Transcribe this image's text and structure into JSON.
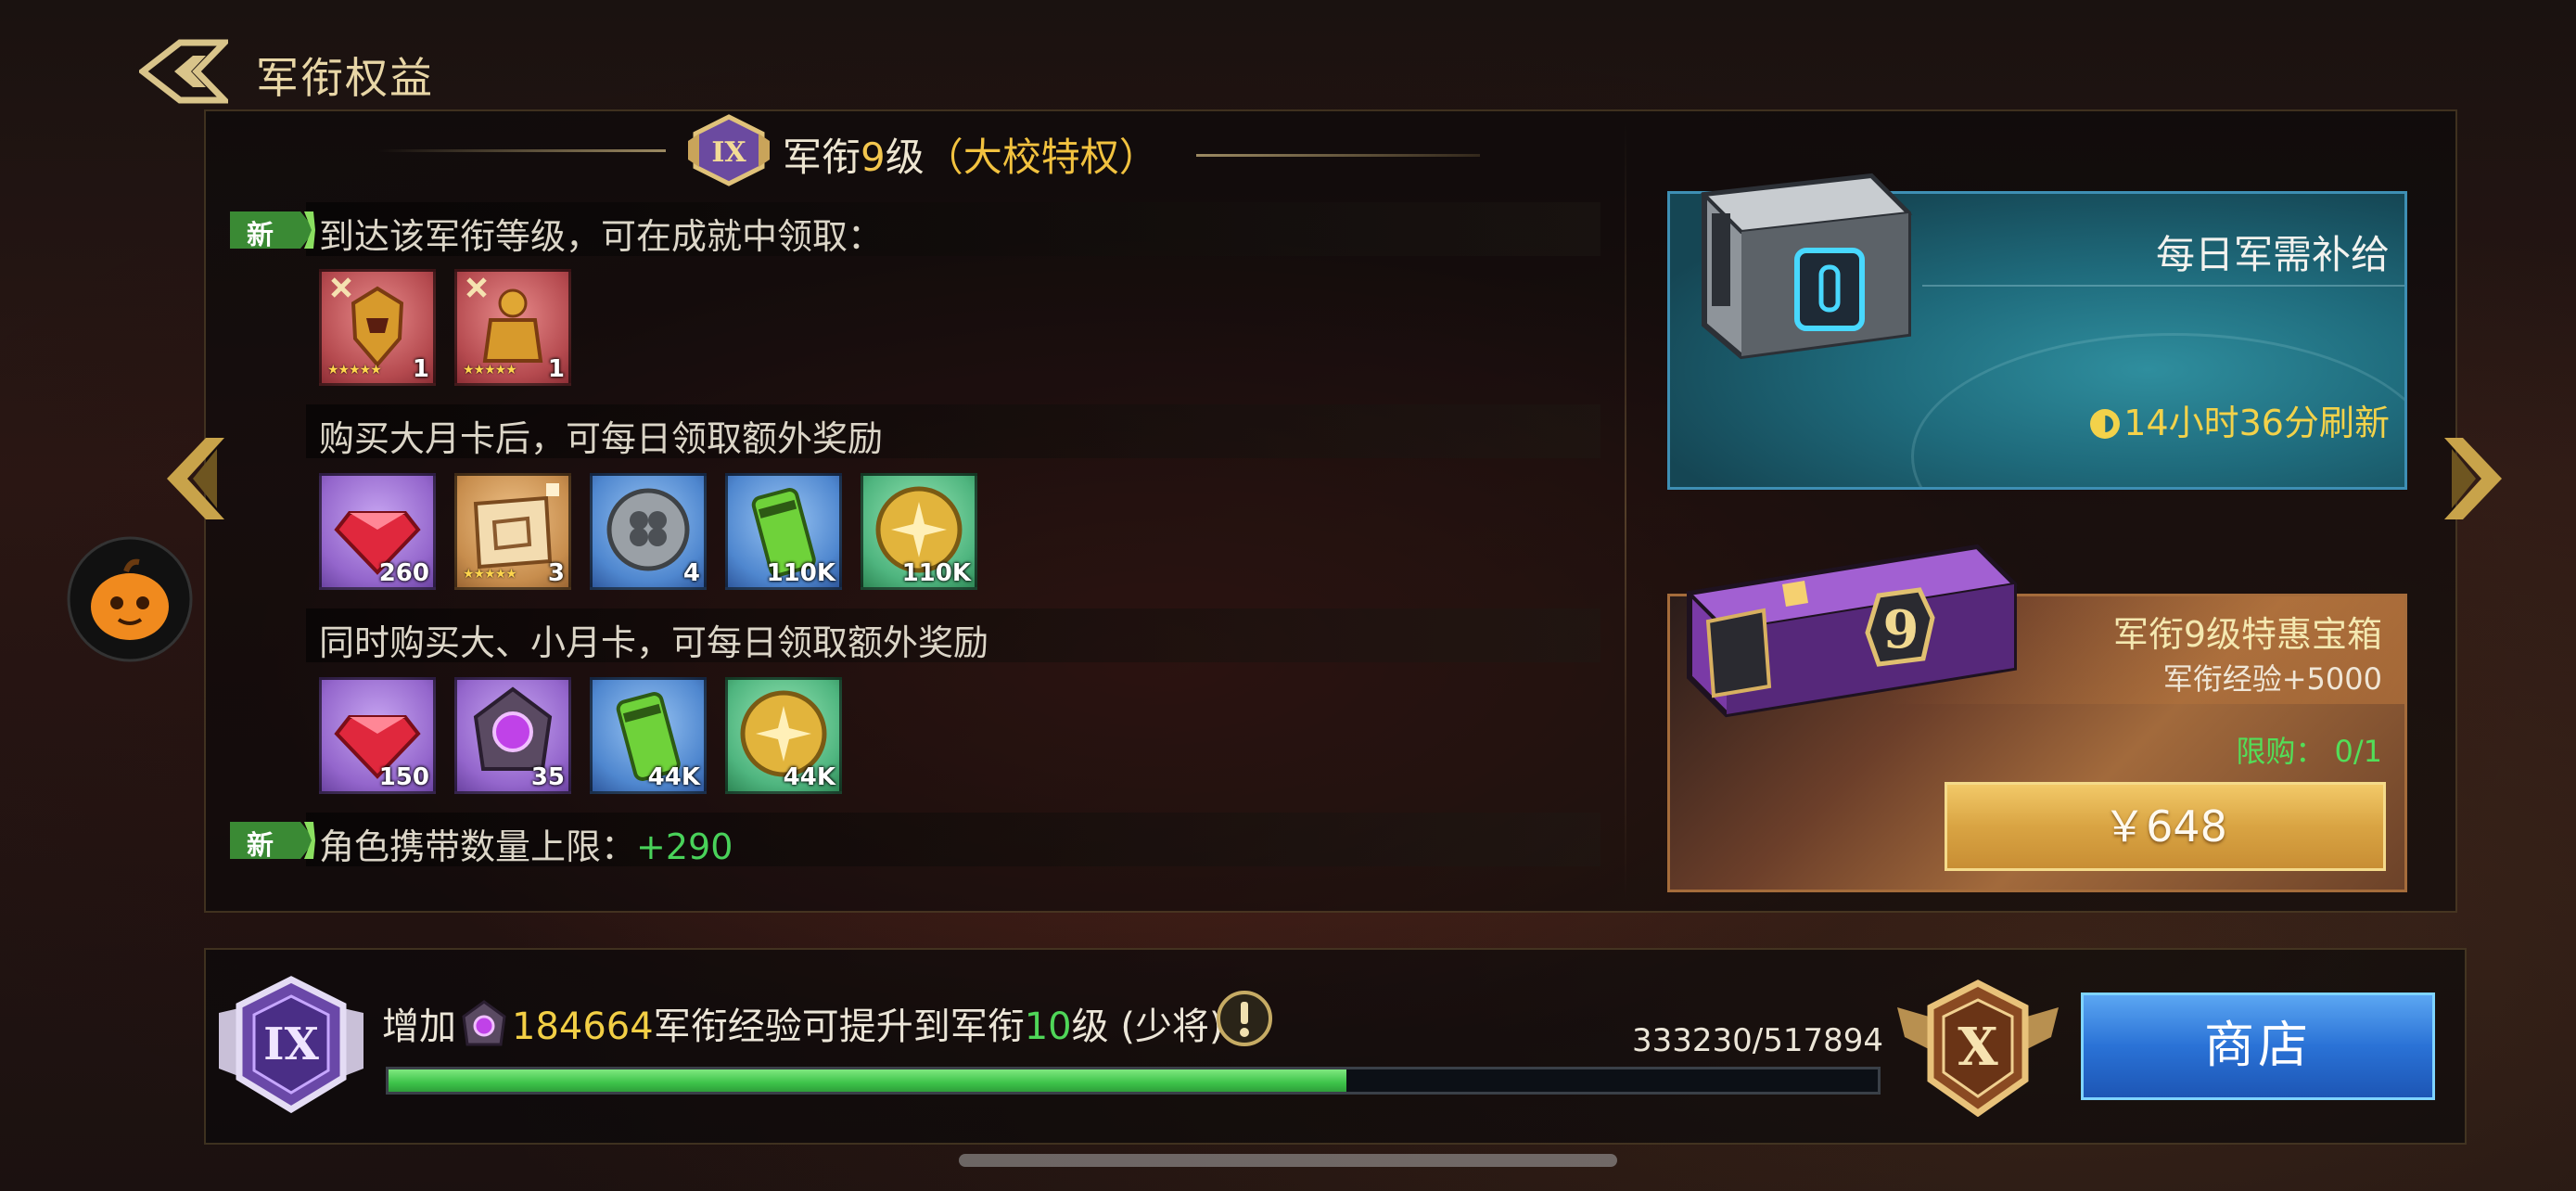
{
  "header": {
    "title": "军衔权益"
  },
  "rank": {
    "badge_numeral": "IX",
    "title_prefix": "军衔",
    "level": "9",
    "title_suffix": "级",
    "privilege": "（大校特权）"
  },
  "sections": [
    {
      "new_tag": "新",
      "text": "到达该军衔等级，可在成就中领取：",
      "items": [
        {
          "icon": "golden-armor-helmet-icon",
          "count": "1",
          "bg": "red",
          "stars": "★★★★★"
        },
        {
          "icon": "golden-armor-suit-icon",
          "count": "1",
          "bg": "red",
          "stars": "★★★★★"
        }
      ]
    },
    {
      "text": "购买大月卡后，可每日领取额外奖励",
      "items": [
        {
          "icon": "red-gem-icon",
          "count": "260",
          "bg": "purple"
        },
        {
          "icon": "map-puzzle-icon",
          "count": "3",
          "bg": "orange",
          "stars": "★★★★★"
        },
        {
          "icon": "clover-coin-icon",
          "count": "4",
          "bg": "blue"
        },
        {
          "icon": "energy-can-icon",
          "count": "110K",
          "bg": "blue"
        },
        {
          "icon": "gold-coin-icon",
          "count": "110K",
          "bg": "green"
        }
      ]
    },
    {
      "text": "同时购买大、小月卡，可每日领取额外奖励",
      "items": [
        {
          "icon": "red-gem-icon",
          "count": "150",
          "bg": "purple"
        },
        {
          "icon": "purple-exp-orb-icon",
          "count": "35",
          "bg": "purple"
        },
        {
          "icon": "energy-can-icon",
          "count": "44K",
          "bg": "blue"
        },
        {
          "icon": "gold-coin-icon",
          "count": "44K",
          "bg": "green"
        }
      ]
    },
    {
      "new_tag": "新",
      "text": "角色携带数量上限：",
      "value": "+290"
    }
  ],
  "daily_supply": {
    "title": "每日军需补给",
    "refresh": "14小时36分刷新"
  },
  "special_chest": {
    "title": "军衔9级特惠宝箱",
    "exp": "军衔经验+5000",
    "limit": "限购：  0/1",
    "price": "￥648",
    "chest_number": "9"
  },
  "progress": {
    "prefix": "增加",
    "exp_needed": "184664",
    "middle": "军衔经验可提升到军衔",
    "next_level": "10",
    "suffix": "级 (少将)",
    "current": "333230/517894",
    "fraction": 0.643,
    "current_badge": "IX",
    "next_badge": "X"
  },
  "shop_button": "商店",
  "colors": {
    "gold": "#f3c64e",
    "green": "#4fd658",
    "shop_blue": "#2a72d6",
    "daily_teal": "#1f6b7c"
  }
}
